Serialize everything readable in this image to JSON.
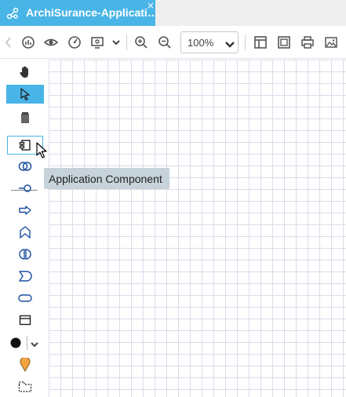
{
  "tab": {
    "title": "ArchiSurance-Applicati…",
    "close_glyph": "×",
    "icon": "diagram-icon"
  },
  "toolbar": {
    "zoom_value": "100%",
    "icons": [
      "back-chevron-icon",
      "analysis-icon",
      "eye-icon",
      "gauge-icon",
      "screen-icon",
      "chevron-down-icon",
      "zoom-in-icon",
      "zoom-out-icon",
      "layout-icon",
      "fit-icon",
      "print-icon",
      "export-image-icon"
    ]
  },
  "palette": {
    "items": [
      "hand-icon",
      "pointer-icon",
      "marquee-icon",
      "application-component-icon",
      "application-collaboration-icon",
      "application-interface-icon",
      "application-function-icon",
      "application-process-icon",
      "application-interaction-icon",
      "application-event-icon",
      "application-service-icon",
      "data-object-icon",
      "junction-icon",
      "location-icon",
      "grouping-icon"
    ],
    "selected": "pointer-icon",
    "hovered": "application-component-icon"
  },
  "tooltip": {
    "text": "Application Component"
  },
  "colors": {
    "accent": "#49b4e6",
    "tooltip_bg": "#c6d3da",
    "grid": "#dcdcec"
  }
}
